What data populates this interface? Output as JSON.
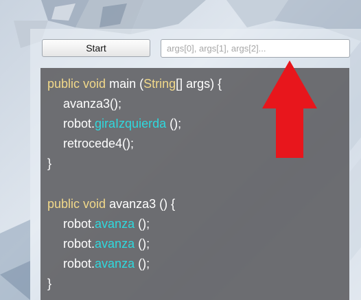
{
  "toolbar": {
    "start_label": "Start",
    "args_placeholder": "args[0], args[1], args[2]..."
  },
  "colors": {
    "keyword": "#f2d98a",
    "method": "#2fd9de",
    "text": "#ffffff",
    "arrow": "#e8161c"
  },
  "code": {
    "l1": {
      "kw1": "public",
      "kw2": "void",
      "name": "main",
      "open": " (",
      "type": "String",
      "rest": "[] args) {"
    },
    "l2": {
      "text": "avanza3();"
    },
    "l3": {
      "obj": "robot.",
      "method": "giraIzquierda",
      "rest": " ();"
    },
    "l4": {
      "text": "retrocede4();"
    },
    "l5": {
      "text": "}"
    },
    "l7": {
      "kw1": "public",
      "kw2": "void",
      "rest": "avanza3 () {"
    },
    "l8": {
      "obj": "robot.",
      "method": "avanza",
      "rest": " ();"
    },
    "l9": {
      "obj": "robot.",
      "method": "avanza",
      "rest": " ();"
    },
    "l10": {
      "obj": "robot.",
      "method": "avanza",
      "rest": " ();"
    },
    "l11": {
      "text": "}"
    }
  },
  "annotation": {
    "icon": "arrow-up-icon"
  }
}
